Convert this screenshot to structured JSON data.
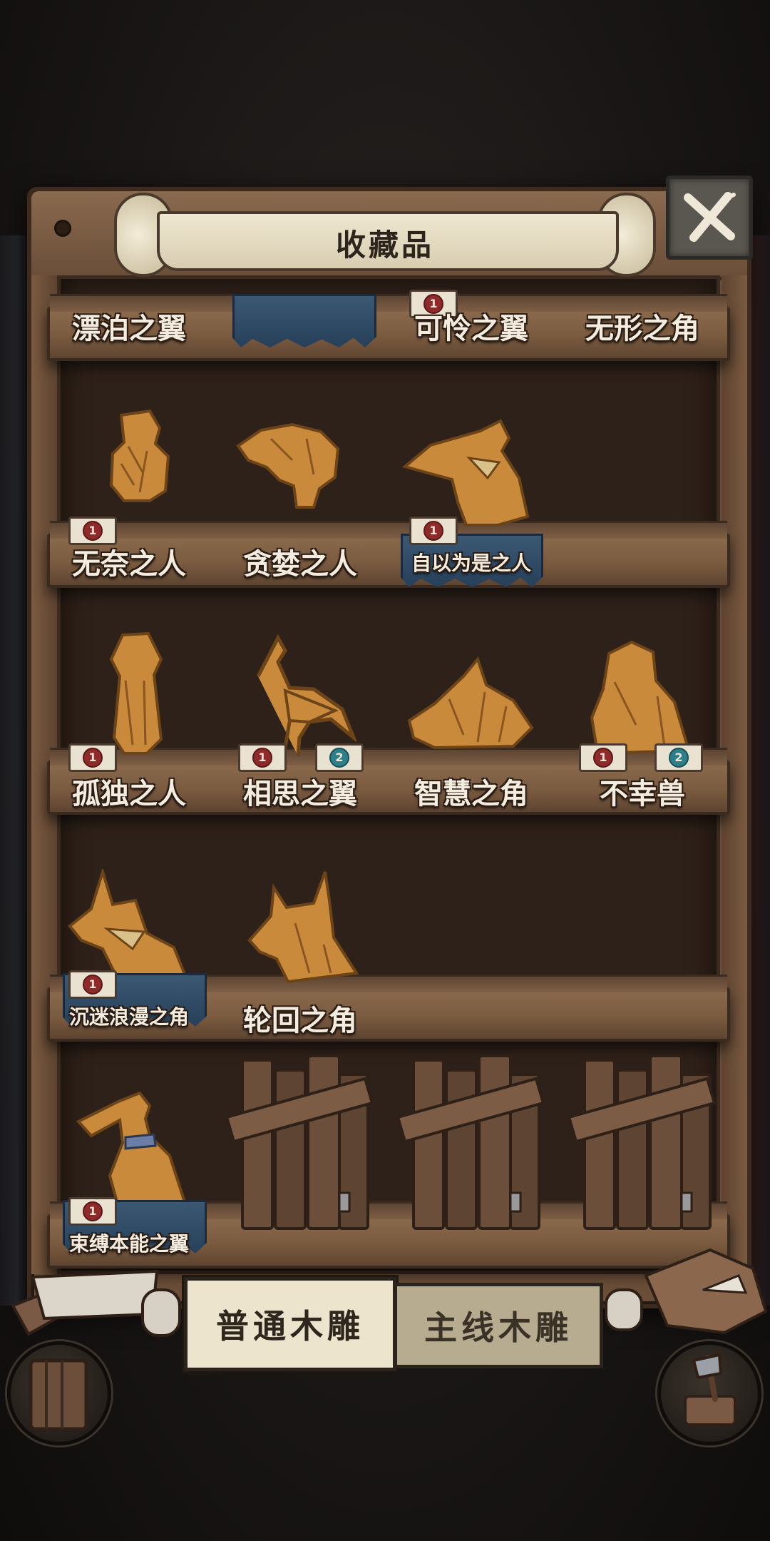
{
  "title": "收藏品",
  "close_label": "",
  "shelves": [
    {
      "slots": [
        {
          "label": "漂泊之翼",
          "seals": []
        },
        {
          "label": "",
          "seals": [],
          "cloth": true
        },
        {
          "label": "可怜之翼",
          "seals": [
            "1"
          ]
        },
        {
          "label": "无形之角",
          "seals": []
        }
      ]
    },
    {
      "slots": [
        {
          "label": "无奈之人",
          "seals": [
            "1"
          ]
        },
        {
          "label": "贪婪之人",
          "seals": []
        },
        {
          "label": "自以为是之人",
          "seals": [
            "1"
          ],
          "cloth": true
        },
        {
          "label": "",
          "seals": []
        }
      ]
    },
    {
      "slots": [
        {
          "label": "孤独之人",
          "seals": [
            "1"
          ]
        },
        {
          "label": "相思之翼",
          "seals": [
            "1",
            "2"
          ]
        },
        {
          "label": "智慧之角",
          "seals": []
        },
        {
          "label": "不幸兽",
          "seals": [
            "1",
            "2"
          ]
        }
      ]
    },
    {
      "slots": [
        {
          "label": "沉迷浪漫之角",
          "seals": [
            "1"
          ],
          "cloth": true
        },
        {
          "label": "轮回之角",
          "seals": []
        },
        {
          "label": "",
          "seals": []
        },
        {
          "label": "",
          "seals": []
        }
      ]
    },
    {
      "slots": [
        {
          "label": "束缚本能之翼",
          "seals": [
            "1"
          ],
          "cloth": true
        },
        {
          "label": "",
          "locked": true
        },
        {
          "label": "",
          "locked": true
        },
        {
          "label": "",
          "locked": true
        }
      ]
    }
  ],
  "tabs": [
    {
      "label": "普通木雕",
      "active": true
    },
    {
      "label": "主线木雕",
      "active": false
    }
  ],
  "colors": {
    "wood": "#6a4e38",
    "cloth": "#2f4a66",
    "seal_red": "#8e2b2a",
    "seal_teal": "#2d7f89"
  }
}
